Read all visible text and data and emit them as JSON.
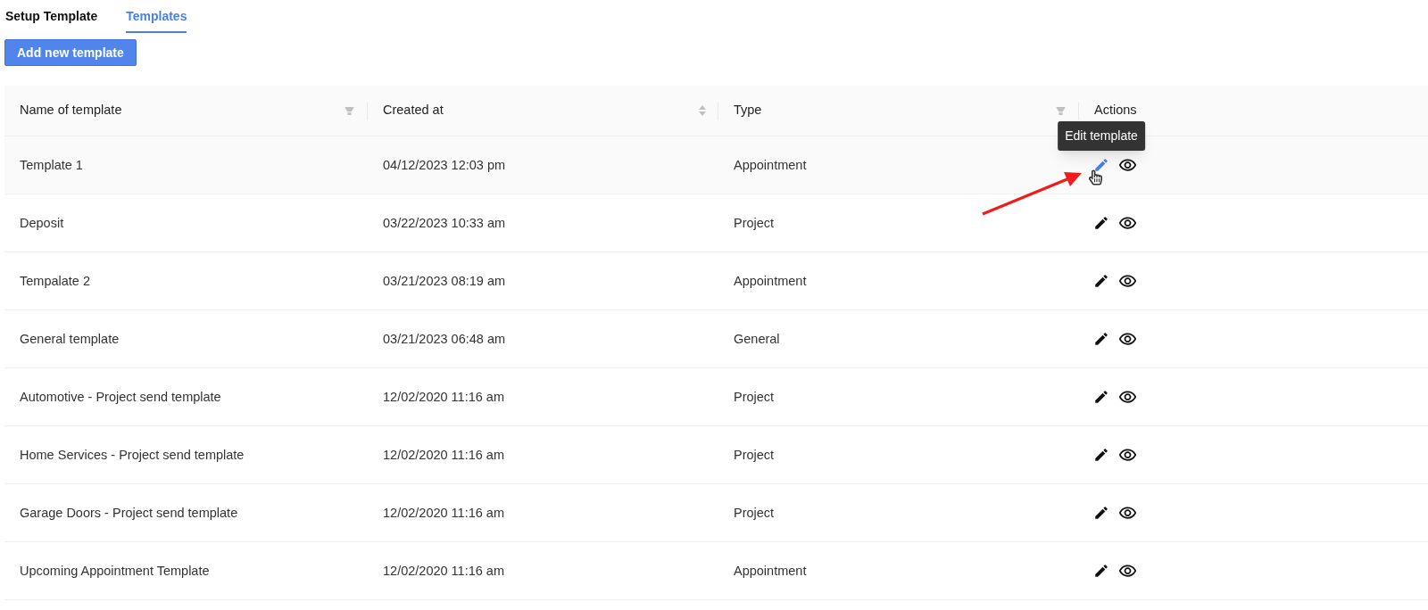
{
  "tabs": [
    {
      "label": "Setup Template",
      "selected": false
    },
    {
      "label": "Templates",
      "selected": true
    }
  ],
  "add_button": "Add new template",
  "table": {
    "columns": [
      {
        "label": "Name of template",
        "kind": "filter"
      },
      {
        "label": "Created at",
        "kind": "sort"
      },
      {
        "label": "Type",
        "kind": "filter"
      },
      {
        "label": "Actions",
        "kind": "plain"
      }
    ],
    "rows": [
      {
        "name": "Template 1",
        "created_at": "04/12/2023 12:03 pm",
        "type": "Appointment",
        "hovered": true
      },
      {
        "name": "Deposit",
        "created_at": "03/22/2023 10:33 am",
        "type": "Project",
        "hovered": false
      },
      {
        "name": "Tempalate 2",
        "created_at": "03/21/2023 08:19 am",
        "type": "Appointment",
        "hovered": false
      },
      {
        "name": "General template",
        "created_at": "03/21/2023 06:48 am",
        "type": "General",
        "hovered": false
      },
      {
        "name": "Automotive - Project send template",
        "created_at": "12/02/2020 11:16 am",
        "type": "Project",
        "hovered": false
      },
      {
        "name": "Home Services - Project send template",
        "created_at": "12/02/2020 11:16 am",
        "type": "Project",
        "hovered": false
      },
      {
        "name": "Garage Doors - Project send template",
        "created_at": "12/02/2020 11:16 am",
        "type": "Project",
        "hovered": false
      },
      {
        "name": "Upcoming Appointment Template",
        "created_at": "12/02/2020 11:16 am",
        "type": "Appointment",
        "hovered": false
      }
    ]
  },
  "tooltip": "Edit template"
}
